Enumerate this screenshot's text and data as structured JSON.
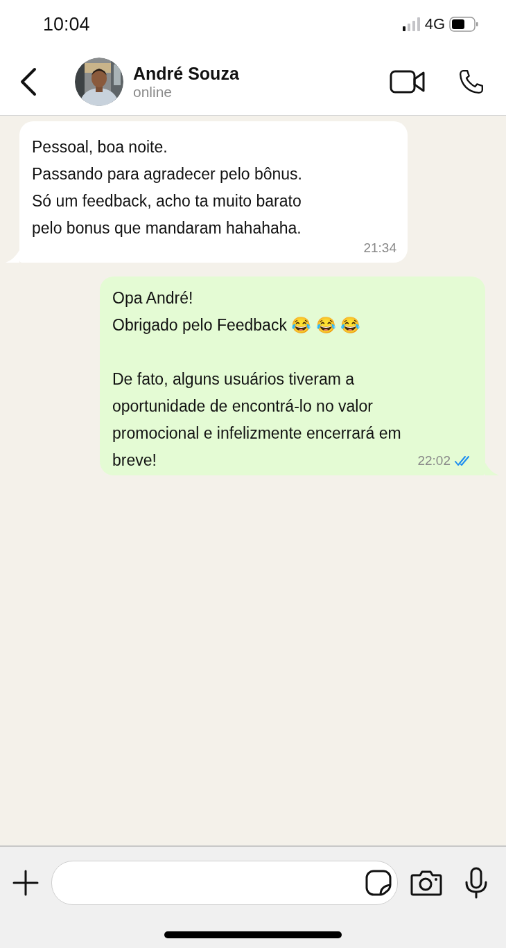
{
  "status_bar": {
    "time": "10:04",
    "network": "4G"
  },
  "header": {
    "name": "André Souza",
    "status": "online"
  },
  "messages": [
    {
      "kind": "incoming",
      "text": "Pessoal, boa noite.\nPassando para agradecer pelo bônus.\nSó um feedback, acho ta muito barato\npelo bonus que mandaram hahahaha.",
      "time": "21:34"
    },
    {
      "kind": "outgoing",
      "text": "Opa André!\nObrigado pelo Feedback 😂 😂 😂\n\nDe fato, alguns usuários tiveram a\noportunidade de encontrá-lo no valor\npromocional e infelizmente encerrará em\nbreve!",
      "time": "22:02",
      "read": true
    }
  ]
}
